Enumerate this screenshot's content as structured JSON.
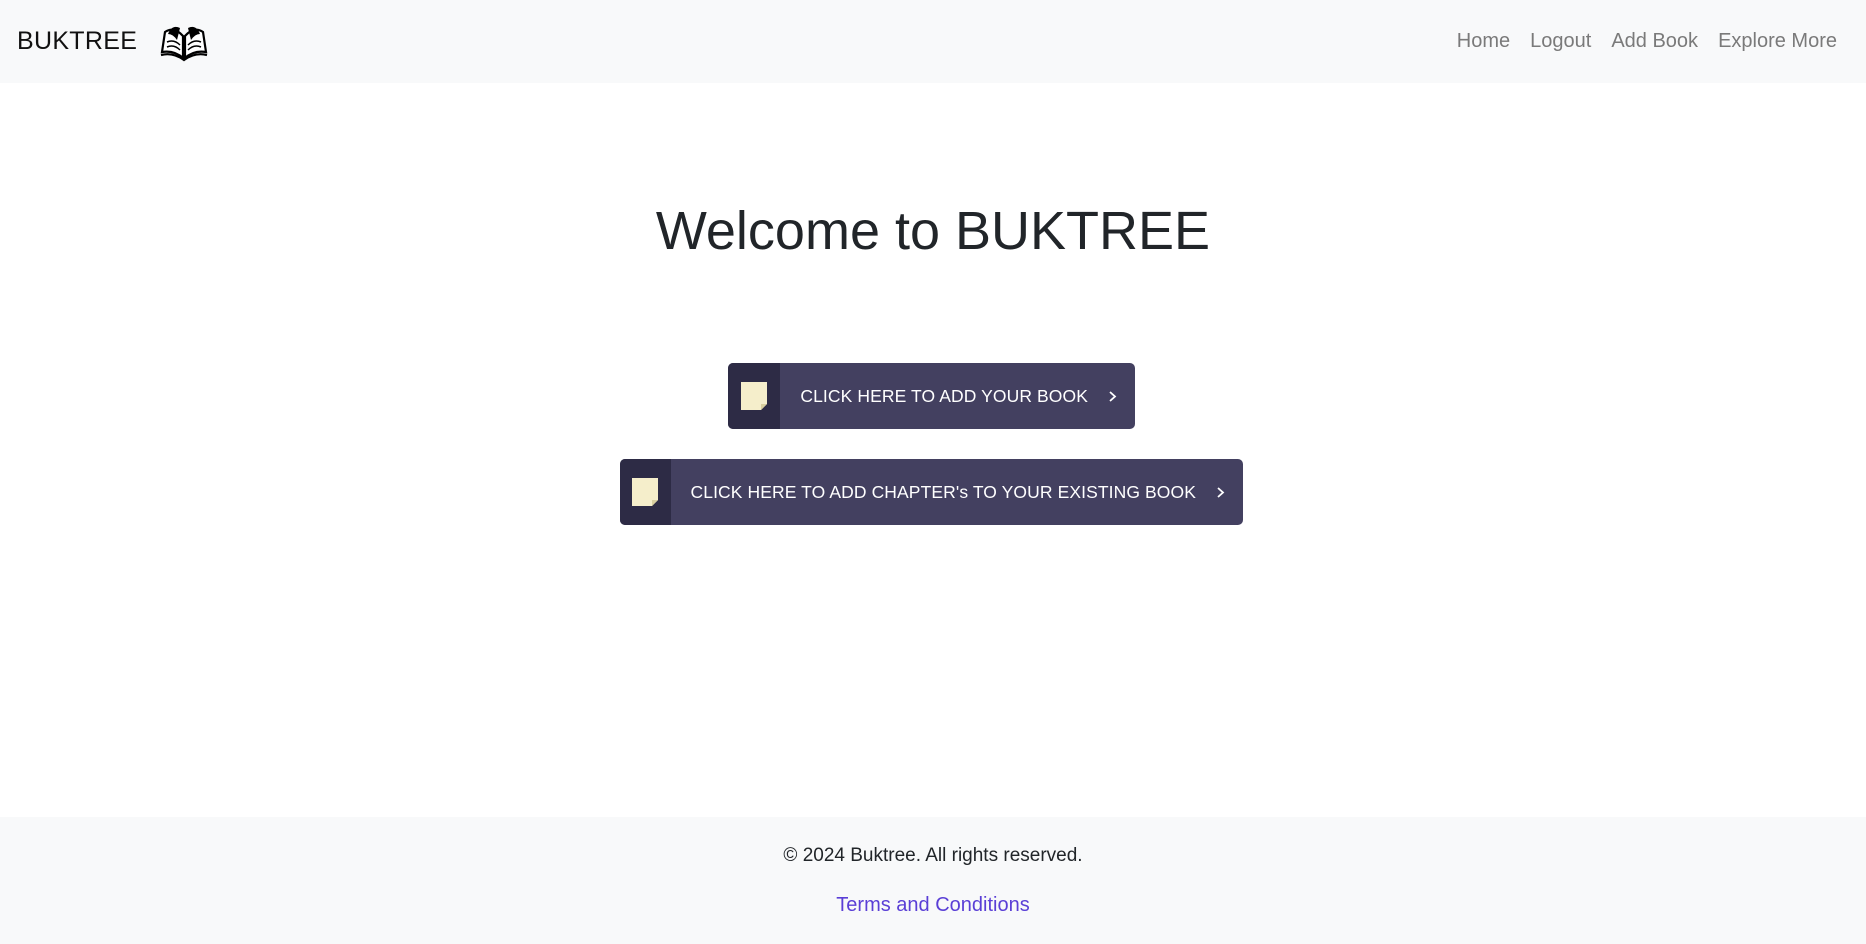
{
  "nav": {
    "brand": "BUKTREE",
    "links": [
      "Home",
      "Logout",
      "Add Book",
      "Explore More"
    ]
  },
  "main": {
    "title": "Welcome to BUKTREE",
    "buttons": [
      {
        "label": "CLICK HERE TO ADD YOUR BOOK",
        "icon": "note-icon"
      },
      {
        "label": "CLICK HERE TO ADD CHAPTER's TO YOUR EXISTING BOOK",
        "icon": "note-icon"
      }
    ]
  },
  "footer": {
    "copyright": "© 2024 Buktree. All rights reserved.",
    "terms": "Terms and Conditions"
  },
  "colors": {
    "navbar_bg": "#f8f9fa",
    "button_bg": "#434060",
    "button_icon_bg": "#2d2b45",
    "note_color": "#f5eecb",
    "link_accent": "#5a3fd6"
  }
}
